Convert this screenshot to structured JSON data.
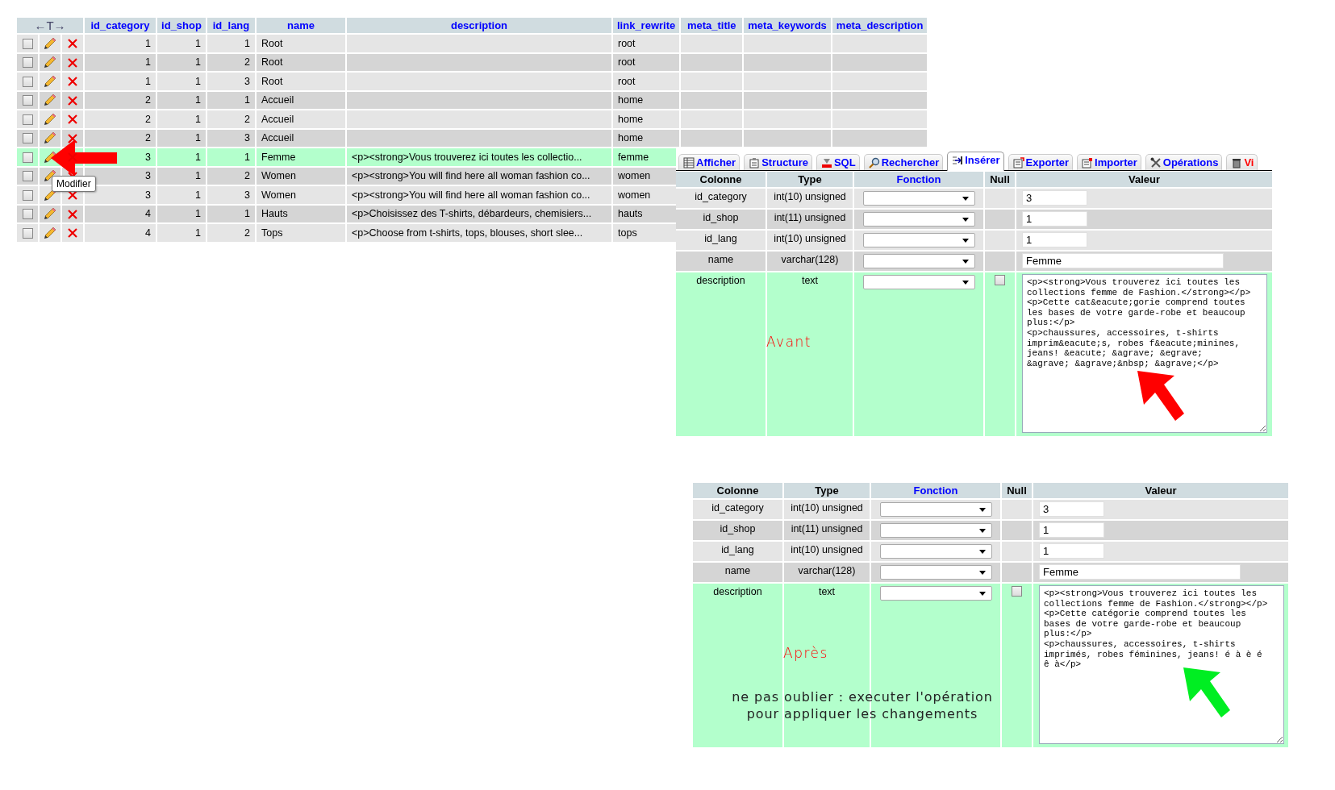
{
  "browse_table": {
    "resize_header": "←T→",
    "columns": [
      {
        "label": "id_category",
        "kind": "number"
      },
      {
        "label": "id_shop",
        "kind": "number"
      },
      {
        "label": "id_lang",
        "kind": "number"
      },
      {
        "label": "name",
        "kind": "text"
      },
      {
        "label": "description",
        "kind": "text"
      },
      {
        "label": "link_rewrite",
        "kind": "text"
      },
      {
        "label": "meta_title",
        "kind": "text"
      },
      {
        "label": "meta_keywords",
        "kind": "text"
      },
      {
        "label": "meta_description",
        "kind": "text"
      }
    ],
    "rows": [
      {
        "checked": false,
        "highlighted": false,
        "cells": [
          "1",
          "1",
          "1",
          "Root",
          null,
          "root",
          null,
          null,
          null
        ]
      },
      {
        "checked": false,
        "highlighted": false,
        "cells": [
          "1",
          "1",
          "2",
          "Root",
          null,
          "root",
          null,
          null,
          null
        ]
      },
      {
        "checked": false,
        "highlighted": false,
        "cells": [
          "1",
          "1",
          "3",
          "Root",
          null,
          "root",
          null,
          null,
          null
        ]
      },
      {
        "checked": false,
        "highlighted": false,
        "cells": [
          "2",
          "1",
          "1",
          "Accueil",
          null,
          "home",
          null,
          null,
          null
        ]
      },
      {
        "checked": false,
        "highlighted": false,
        "cells": [
          "2",
          "1",
          "2",
          "Accueil",
          null,
          "home",
          null,
          null,
          null
        ]
      },
      {
        "checked": false,
        "highlighted": false,
        "cells": [
          "2",
          "1",
          "3",
          "Accueil",
          null,
          "home",
          null,
          null,
          null
        ]
      },
      {
        "checked": false,
        "highlighted": true,
        "cells": [
          "3",
          "1",
          "1",
          "Femme",
          "<p><strong>Vous trouverez ici toutes les collectio...",
          "femme",
          null,
          null,
          null
        ]
      },
      {
        "checked": false,
        "highlighted": false,
        "cells": [
          "3",
          "1",
          "2",
          "Women",
          "<p><strong>You will find here all woman fashion co...",
          "women",
          null,
          null,
          null
        ]
      },
      {
        "checked": false,
        "highlighted": false,
        "cells": [
          "3",
          "1",
          "3",
          "Women",
          "<p><strong>You will find here all woman fashion co...",
          "women",
          null,
          null,
          null
        ]
      },
      {
        "checked": false,
        "highlighted": false,
        "cells": [
          "4",
          "1",
          "1",
          "Hauts",
          "<p>Choisissez des T-shirts, débardeurs, chemisiers...",
          "hauts",
          null,
          null,
          null
        ]
      },
      {
        "checked": false,
        "highlighted": false,
        "cells": [
          "4",
          "1",
          "2",
          "Tops",
          "<p>Choose from t-shirts, tops, blouses, short slee...",
          "tops",
          null,
          null,
          null
        ]
      }
    ],
    "tooltip": "Modifier"
  },
  "insert_panels": [
    {
      "tabs": [
        {
          "label": "Afficher",
          "selected": false,
          "kind": "normal"
        },
        {
          "label": "Structure",
          "selected": false,
          "kind": "normal"
        },
        {
          "label": "SQL",
          "selected": false,
          "kind": "normal"
        },
        {
          "label": "Rechercher",
          "selected": false,
          "kind": "normal"
        },
        {
          "label": "Insérer",
          "selected": true,
          "kind": "normal"
        },
        {
          "label": "Exporter",
          "selected": false,
          "kind": "normal"
        },
        {
          "label": "Importer",
          "selected": false,
          "kind": "normal"
        },
        {
          "label": "Opérations",
          "selected": false,
          "kind": "normal"
        },
        {
          "label": "Vi",
          "selected": false,
          "kind": "danger"
        }
      ],
      "columns": [
        {
          "label": "Colonne",
          "kind": "plain"
        },
        {
          "label": "Type",
          "kind": "plain"
        },
        {
          "label": "Fonction",
          "kind": "link"
        },
        {
          "label": "Null",
          "kind": "plain"
        },
        {
          "label": "Valeur",
          "kind": "plain"
        }
      ],
      "fields": [
        {
          "name": "id_category",
          "type": "int(10) unsigned",
          "value": "3",
          "kind": "number",
          "highlighted": false
        },
        {
          "name": "id_shop",
          "type": "int(11) unsigned",
          "value": "1",
          "kind": "number",
          "highlighted": false
        },
        {
          "name": "id_lang",
          "type": "int(10) unsigned",
          "value": "1",
          "kind": "number",
          "highlighted": false
        },
        {
          "name": "name",
          "type": "varchar(128)",
          "value": "Femme",
          "kind": "text",
          "highlighted": false
        },
        {
          "name": "description",
          "type": "text",
          "value": "<p><strong>Vous trouverez ici toutes les collections femme de Fashion.</strong></p>\n<p>Cette cat&eacute;gorie comprend toutes les bases de votre garde-robe et beaucoup plus:</p>\n<p>chaussures, accessoires, t-shirts imprim&eacute;s, robes f&eacute;minines, jeans! &eacute; &agrave; &egrave;\n&agrave; &agrave;&nbsp; &agrave;</p>",
          "kind": "textarea",
          "highlighted": true,
          "null_checked": false
        }
      ],
      "annotation": "Avant",
      "color": "#ff0000"
    },
    {
      "columns": [
        {
          "label": "Colonne",
          "kind": "plain"
        },
        {
          "label": "Type",
          "kind": "plain"
        },
        {
          "label": "Fonction",
          "kind": "link"
        },
        {
          "label": "Null",
          "kind": "plain"
        },
        {
          "label": "Valeur",
          "kind": "plain"
        }
      ],
      "fields": [
        {
          "name": "id_category",
          "type": "int(10) unsigned",
          "value": "3",
          "kind": "number",
          "highlighted": false
        },
        {
          "name": "id_shop",
          "type": "int(11) unsigned",
          "value": "1",
          "kind": "number",
          "highlighted": false
        },
        {
          "name": "id_lang",
          "type": "int(10) unsigned",
          "value": "1",
          "kind": "number",
          "highlighted": false
        },
        {
          "name": "name",
          "type": "varchar(128)",
          "value": "Femme",
          "kind": "text",
          "highlighted": false
        },
        {
          "name": "description",
          "type": "text",
          "value": "<p><strong>Vous trouverez ici toutes les collections femme de Fashion.</strong></p>\n<p>Cette catégorie comprend toutes les bases de votre garde-robe et beaucoup plus:</p>\n<p>chaussures, accessoires, t-shirts imprimés, robes féminines, jeans! é à è é ê à</p>",
          "kind": "textarea",
          "highlighted": true,
          "null_checked": false
        }
      ],
      "annotation": "Après",
      "color": "#00ee22",
      "note": [
        "ne pas oublier : executer l'opération",
        "pour appliquer les changements"
      ]
    }
  ]
}
